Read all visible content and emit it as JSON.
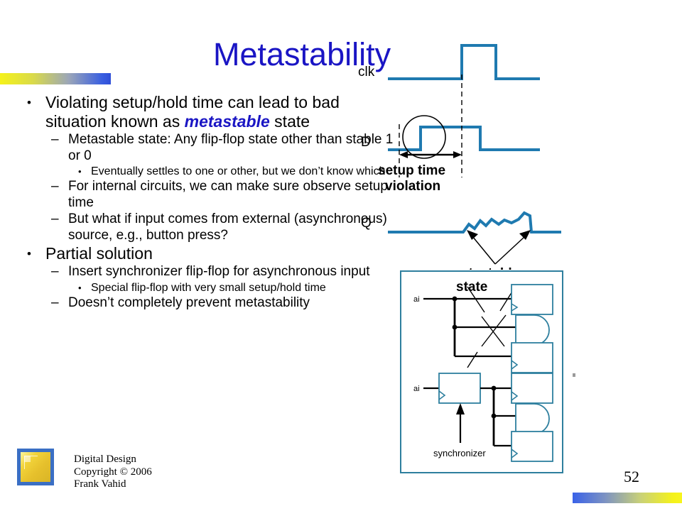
{
  "slide": {
    "title": "Metastability",
    "page_number": "52"
  },
  "body": {
    "bullets": [
      {
        "level": 1,
        "marker": "•",
        "text_before": "Violating setup/hold time can lead to bad situation known as ",
        "emphasis": "metastable",
        "text_after": " state"
      },
      {
        "level": 2,
        "marker": "–",
        "text": "Metastable state: Any flip-flop state other than stable 1 or 0"
      },
      {
        "level": 3,
        "marker": "•",
        "text": "Eventually settles to one or other, but we don’t know which"
      },
      {
        "level": 2,
        "marker": "–",
        "text": "For internal circuits, we can make sure observe setup time"
      },
      {
        "level": 2,
        "marker": "–",
        "text": "But what if input comes from external (asynchronous) source, e.g., button press?"
      },
      {
        "level": 1,
        "marker": "•",
        "text": "Partial solution"
      },
      {
        "level": 2,
        "marker": "–",
        "text": "Insert synchronizer flip-flop for asynchronous input"
      },
      {
        "level": 3,
        "marker": "•",
        "text": "Special flip-flop with very small setup/hold time"
      },
      {
        "level": 2,
        "marker": "–",
        "text": "Doesn’t completely prevent metastability"
      }
    ]
  },
  "timing_figure": {
    "signals": [
      {
        "name": "clk"
      },
      {
        "name": "D"
      },
      {
        "name": "Q"
      }
    ],
    "annotations": [
      {
        "id": "setup-violation",
        "line1": "setup time",
        "line2": "violation"
      },
      {
        "id": "metastable-state",
        "line1": "metastable",
        "line2": "state"
      }
    ],
    "waveform_color": "#1f7ab0"
  },
  "circuit_figure": {
    "border_color": "#2e7f9e",
    "gate_color": "#2e7f9e",
    "wire_color": "#000000",
    "top_circuit": {
      "input_label": "ai"
    },
    "bottom_circuit": {
      "input_label": "ai",
      "callout_label": "synchronizer"
    }
  },
  "footer": {
    "line1": "Digital Design",
    "line2": "Copyright © 2006",
    "line3": "Frank Vahid"
  },
  "colors": {
    "title_blue": "#1a15c4",
    "accent_yellow": "#f5f21a",
    "accent_blue": "#3a5fe0",
    "waveform": "#1f7ab0",
    "circuit": "#2e7f9e"
  }
}
